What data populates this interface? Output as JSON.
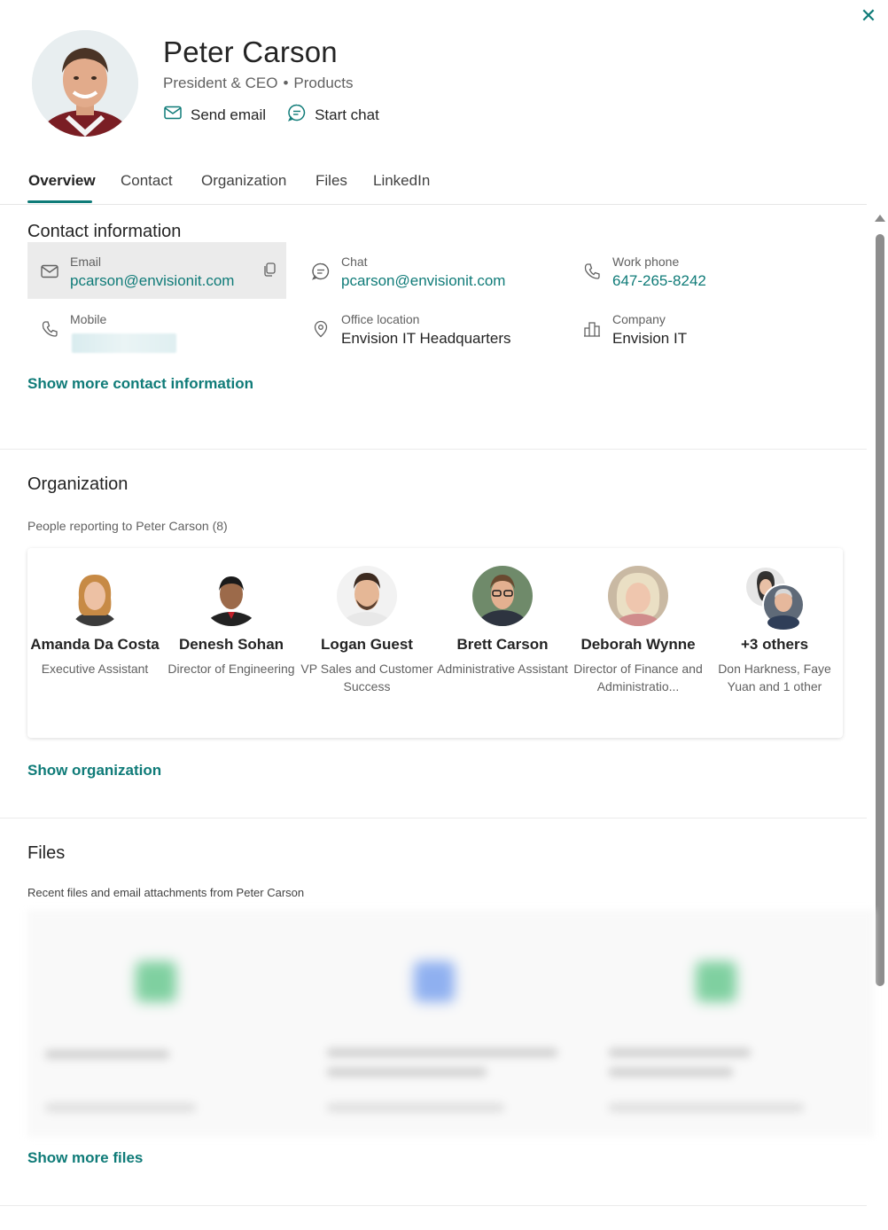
{
  "profile": {
    "name": "Peter Carson",
    "title": "President & CEO",
    "department": "Products",
    "separator": "•",
    "send_email_label": "Send email",
    "start_chat_label": "Start chat",
    "close_label": "✕"
  },
  "tabs": [
    {
      "label": "Overview",
      "active": true
    },
    {
      "label": "Contact",
      "active": false
    },
    {
      "label": "Organization",
      "active": false
    },
    {
      "label": "Files",
      "active": false
    },
    {
      "label": "LinkedIn",
      "active": false
    }
  ],
  "contact": {
    "heading": "Contact information",
    "email": {
      "label": "Email",
      "value": "pcarson@envisionit.com",
      "icon": "mail-icon"
    },
    "chat": {
      "label": "Chat",
      "value": "pcarson@envisionit.com",
      "icon": "chat-icon"
    },
    "work_phone": {
      "label": "Work phone",
      "value": "647-265-8242",
      "icon": "phone-icon"
    },
    "mobile": {
      "label": "Mobile",
      "icon": "phone-icon"
    },
    "office": {
      "label": "Office location",
      "value": "Envision IT Headquarters",
      "icon": "location-icon"
    },
    "company": {
      "label": "Company",
      "value": "Envision IT",
      "icon": "building-icon"
    },
    "show_more": "Show more contact information"
  },
  "organization": {
    "heading": "Organization",
    "subheading": "People reporting to Peter Carson (8)",
    "people": [
      {
        "name": "Amanda Da Costa",
        "title": "Executive Assistant"
      },
      {
        "name": "Denesh Sohan",
        "title": "Director of Engineering"
      },
      {
        "name": "Logan Guest",
        "title": "VP Sales and Customer Success"
      },
      {
        "name": "Brett Carson",
        "title": "Administrative Assistant"
      },
      {
        "name": "Deborah Wynne",
        "title": "Director of Finance and Administratio..."
      },
      {
        "name": "+3 others",
        "title": "Don Harkness, Faye Yuan and 1 other"
      }
    ],
    "show_link": "Show organization"
  },
  "files": {
    "heading": "Files",
    "subheading": "Recent files and email attachments from Peter Carson",
    "show_link": "Show more files"
  },
  "colors": {
    "accent": "#0f7b78",
    "text": "#242424",
    "muted": "#616161"
  }
}
